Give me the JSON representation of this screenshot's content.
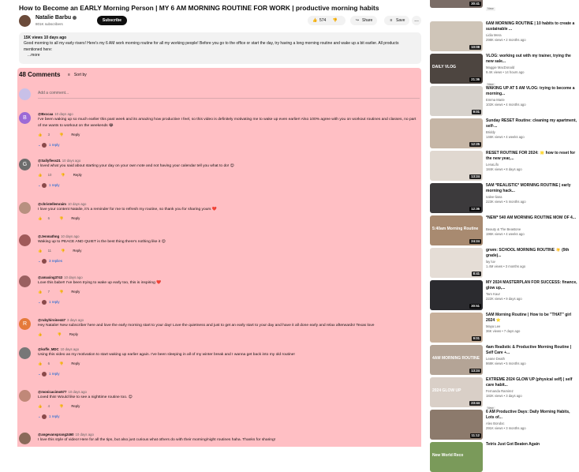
{
  "video": {
    "title": "How to Become an EARLY Morning Person | MY 6 AM MORNING ROUTINE FOR WORK | productive morning habits",
    "channel": "Natalie Barbu",
    "subscribers": "801K subscribers",
    "subscribe_label": "Subscribe",
    "likes": "574",
    "share_label": "Share",
    "save_label": "Save",
    "more_label": "...",
    "description": {
      "meta": "15K views  10 days ago",
      "text": "Good morning to all my early risers! Here's my 6 AM work morning routine for all my working people! Before you go to the office or start the day, try having a long morning routine and wake up a bit earlier. All products mentioned here:",
      "more": "...more"
    }
  },
  "comments_section": {
    "count_label": "48 Comments",
    "sort_label": "Sort by",
    "add_placeholder": "Add a comment...",
    "comments": [
      {
        "handle": "@Bxccaa",
        "time": "10 days ago",
        "avatar_letter": "B",
        "avatar_color": "#9c6ad6",
        "text": "I've been waking up so much earlier this past week and its amazing how productive I feel, so this video is definitely motivating me to wake up even earlier! Also 100% agree with you on workout routines and classes, no part of me wants to workout on the weekends 😂",
        "likes": "3",
        "reply_label": "Reply",
        "replies": "1 reply"
      },
      {
        "handle": "@Sallyfless21",
        "time": "10 days ago",
        "avatar_letter": "G",
        "avatar_color": "#6c6c6c",
        "text": "I loved what you said about starting your day on your own note and not having your calendar tell you what to do! 😊",
        "likes": "10",
        "reply_label": "Reply",
        "replies": "1 reply"
      },
      {
        "handle": "@christellemraim",
        "time": "10 days ago",
        "avatar_letter": "",
        "avatar_color": "#b89080",
        "text": "I love your content Natalie, it's a reminder for me to refresh my routine, so thank you for sharing yours ❤️",
        "likes": "6",
        "reply_label": "Reply",
        "replies": ""
      },
      {
        "handle": "@Jenmathng",
        "time": "10 days ago",
        "avatar_letter": "",
        "avatar_color": "#a05a5a",
        "text": "Waking up to PEACE AND QUIET is the best thing there's nothing like it 😊",
        "likes": "11",
        "reply_label": "Reply",
        "replies": "3 replies"
      },
      {
        "handle": "@amaxing3743",
        "time": "10 days ago",
        "avatar_letter": "",
        "avatar_color": "#9a6060",
        "text": "Love this babe!! I've been trying to wake up early too, this is inspiring ❤️",
        "likes": "7",
        "reply_label": "Reply",
        "replies": "1 reply"
      },
      {
        "handle": "@rubyhiroine447",
        "time": "3 days ago",
        "avatar_letter": "R",
        "avatar_color": "#e57a3a",
        "text": "Hey Natalie! New subscriber here and love the early morning start to your day! Love the quietness and just to get an early start to your day and have it all done early and relax afterwards! Texas love",
        "likes": "",
        "reply_label": "Reply",
        "replies": ""
      },
      {
        "handle": "@koffe_MDC",
        "time": "10 days ago",
        "avatar_letter": "",
        "avatar_color": "#777777",
        "text": "Using this video as my motivation to start waking up earlier again. I've been sleeping in all of my winter break and I wanna get back into my old routine!",
        "likes": "6",
        "reply_label": "Reply",
        "replies": "1 reply"
      },
      {
        "handle": "@monicacimo577",
        "time": "10 days ago",
        "avatar_letter": "",
        "avatar_color": "#c08878",
        "text": "Loved this! Would like to see a nighttime routine too. 😊",
        "likes": "4",
        "reply_label": "Reply",
        "replies": "1 reply"
      },
      {
        "handle": "@angevansprang2460",
        "time": "10 days ago",
        "avatar_letter": "",
        "avatar_color": "#8a6a5a",
        "text": "I love this style of video! Here for all the tips, but also just curious what others do with their morning/night routines haha. Thanks for sharing!",
        "likes": "",
        "reply_label": "",
        "replies": ""
      }
    ]
  },
  "sidebar": {
    "videos": [
      {
        "title": "",
        "channel": "annika lief",
        "meta": "70K views • 19 hours ago",
        "duration": "30:41",
        "badge": "New",
        "thumb_color": "#7a6c66",
        "thumb_text": ""
      },
      {
        "title": "6AM MORNING ROUTINE | 10 habits to create a sustainable ...",
        "channel": "Lidia Mera",
        "meta": "298K views • 2 months ago",
        "duration": "10:08",
        "badge": "",
        "thumb_color": "#cfc5b8",
        "thumb_text": ""
      },
      {
        "title": "VLOG: working out with my trainer, trying the new sale...",
        "channel": "Maggie MacDonald",
        "meta": "9.4K views • 14 hours ago",
        "duration": "21:36",
        "badge": "New",
        "thumb_color": "#4d4540",
        "thumb_text": "DAILY VLOG"
      },
      {
        "title": "WAKING UP AT 5 AM VLOG: trying to become a morning...",
        "channel": "Emma Marie",
        "meta": "102K views • 4 months ago",
        "duration": "9:01",
        "badge": "",
        "thumb_color": "#d7d2cc",
        "thumb_text": ""
      },
      {
        "title": "Sunday RESET Routine: cleaning my apartment, self-...",
        "channel": "Briddy",
        "meta": "146K views • 4 weeks ago",
        "duration": "12:25",
        "badge": "",
        "thumb_color": "#c6b6a6",
        "thumb_text": ""
      },
      {
        "title": "RESET ROUTINE FOR 2024: 🌟 how to reset for the new year,...",
        "channel": "LenaLifo",
        "meta": "184K views • 8 days ago",
        "duration": "13:24",
        "badge": "",
        "thumb_color": "#e0d8d0",
        "thumb_text": ""
      },
      {
        "title": "5AM *REALISTIC* MORNING ROUTINE | early morning hack...",
        "channel": "nalee-liana",
        "meta": "223K views • 5 months ago",
        "duration": "12:36",
        "badge": "",
        "thumb_color": "#3c3a3c",
        "thumb_text": ""
      },
      {
        "title": "*NEW* 540 AM MORNING ROUTINE MOM OF 4...",
        "channel": "Beauty & The Beastone",
        "meta": "196K views • 4 weeks ago",
        "duration": "24:24",
        "badge": "",
        "thumb_color": "#a88a70",
        "thumb_text": "5:40am Morning Routine"
      },
      {
        "title": "grwm: SCHOOL MORNING ROUTINE ☀️ (9th grade)...",
        "channel": "lay luv",
        "meta": "1.4M views • 3 months ago",
        "duration": "8:41",
        "badge": "",
        "thumb_color": "#e5ddd6",
        "thumb_text": ""
      },
      {
        "title": "MY 2024 MASTERPLAN FOR SUCCESS: finance, glow up,...",
        "channel": "Tam Kaur",
        "meta": "222K views • 9 days ago",
        "duration": "30:51",
        "badge": "",
        "thumb_color": "#2b2b2f",
        "thumb_text": ""
      },
      {
        "title": "5AM Morning Routine | How to be \"THAT\" girl 2024 ⭐",
        "channel": "Maya Lee",
        "meta": "36K views • 7 days ago",
        "duration": "9:01",
        "badge": "",
        "thumb_color": "#c7b09b",
        "thumb_text": ""
      },
      {
        "title": "4am Realistic & Productive Morning Routine | Self Care +...",
        "channel": "Leane Death",
        "meta": "868K views • 5 months ago",
        "duration": "13:24",
        "badge": "",
        "thumb_color": "#b4a496",
        "thumb_text": "4AM MORNING ROUTINE"
      },
      {
        "title": "EXTREME 2024 GLOW UP (physical self) | self care habit...",
        "channel": "Fernanda Ramirez",
        "meta": "182K views • 3 days ago",
        "duration": "23:44",
        "badge": "New",
        "thumb_color": "#d9cfc7",
        "thumb_text": "2024 GLOW UP"
      },
      {
        "title": "6 AM Productive Days: Daily Morning Habits, Lots of...",
        "channel": "Alex Bondoc",
        "meta": "291K views • 3 months ago",
        "duration": "11:12",
        "badge": "",
        "thumb_color": "#8c7a6c",
        "thumb_text": ""
      },
      {
        "title": "Tetris Just Got Beaten Again",
        "channel": "",
        "meta": "",
        "duration": "",
        "badge": "",
        "thumb_color": "#7a9a5a",
        "thumb_text": "New World Reco"
      }
    ]
  }
}
